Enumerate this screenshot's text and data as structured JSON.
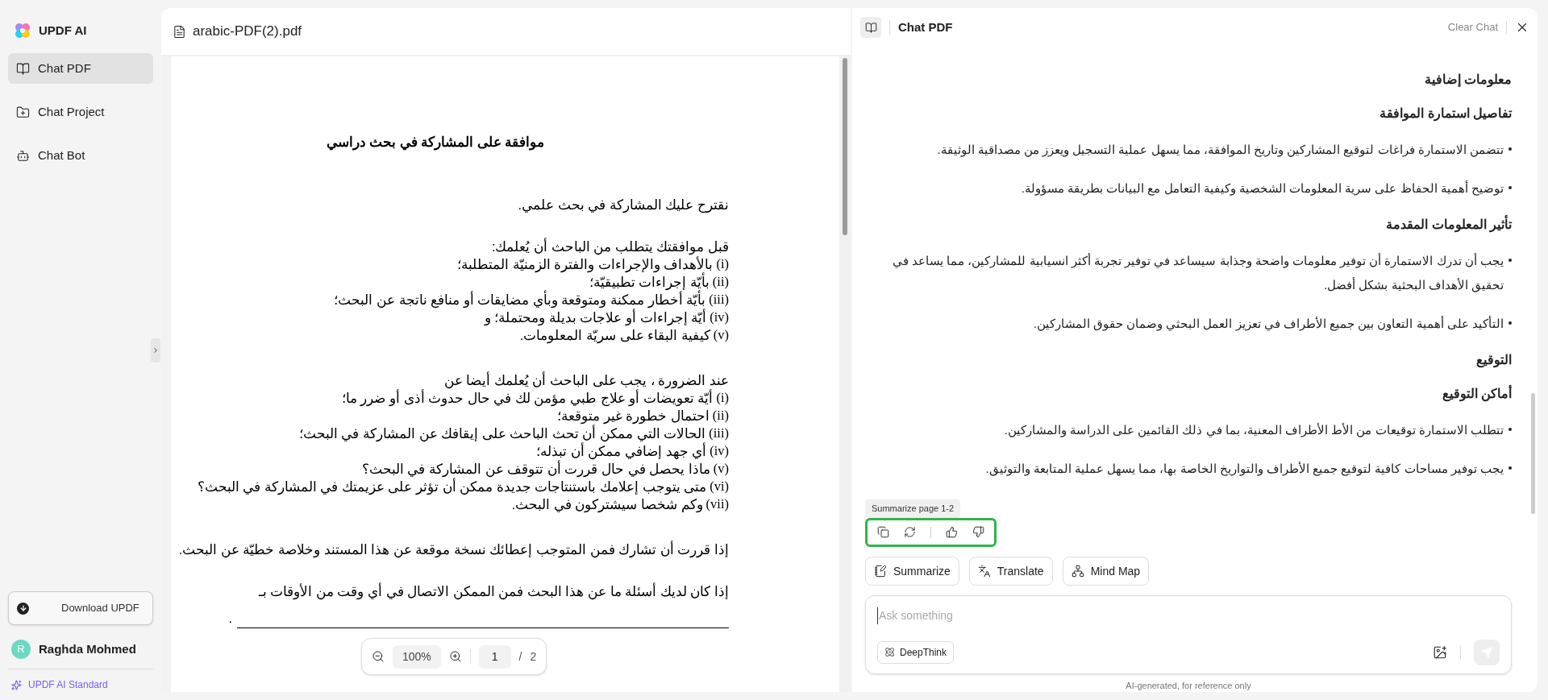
{
  "app": {
    "name": "UPDF AI"
  },
  "sidebar": {
    "items": [
      {
        "label": "Chat PDF",
        "kind": "pdf",
        "selected": true
      },
      {
        "label": "Chat Project",
        "kind": "project",
        "selected": false
      },
      {
        "label": "Chat Bot",
        "kind": "bot",
        "selected": false
      }
    ],
    "download_button": "Download UPDF",
    "user": {
      "initial": "R",
      "name": "Raghda Mohmed"
    },
    "plan": "UPDF AI Standard"
  },
  "document": {
    "filename": "arabic-PDF(2).pdf",
    "title": "موافقة على المشاركة في بحث دراسي",
    "blocks": [
      {
        "kind": "para",
        "text": "نقترح عليك المشاركة في بحث علمي."
      },
      {
        "kind": "list",
        "intro": "قبل موافقتك يتطلب من الباحث أن يُعلمك:",
        "items": [
          {
            "marker": "(i)",
            "text": "بالأهداف والإجراءات والفترة الزمنيّة المتطلبة؛"
          },
          {
            "marker": "(ii)",
            "text": "بأيّة إجراءات تطبيقيّة؛"
          },
          {
            "marker": "(iii)",
            "text": "بأيّة أخطار ممكنة ومتوقعة وبأي مضايقات أو منافع ناتجة عن البحث؛"
          },
          {
            "marker": "(iv)",
            "text": "أيّة إجراءات أو علاجات بديلة ومحتملة؛ و"
          },
          {
            "marker": "(v)",
            "text": "كيفية البقاء على سريّة المعلومات."
          }
        ]
      },
      {
        "kind": "list",
        "intro": "عند الضرورة ، يجب على الباحث أن يُعلمك أيضا عن",
        "items": [
          {
            "marker": "(i)",
            "text": "أيّة تعويضات أو علاج طبي مؤمن لك في حال حدوث أذى أو ضرر ما؛"
          },
          {
            "marker": "(ii)",
            "text": "احتمال خطورة غير متوقعة؛"
          },
          {
            "marker": "(iii)",
            "text": "الحالات التي ممكن أن تحث الباحث على إيقافك عن المشاركة في البحث؛"
          },
          {
            "marker": "(iv)",
            "text": "أي جهد إضافي ممكن أن تبذله؛"
          },
          {
            "marker": "(v)",
            "text": "ماذا يحصل في حال قررت أن تتوقف عن المشاركة في البحث؟"
          },
          {
            "marker": "(vi)",
            "text": "متى يتوجب إعلامك باستنتاجات جديدة ممكن أن تؤثر على عزيمتك في المشاركة في البحث؟"
          },
          {
            "marker": "(vii)",
            "text": "وكم شخصا سيشتركون في البحث."
          }
        ]
      },
      {
        "kind": "para",
        "text": "إذا قررت أن تشارك فمن المتوجب إعطائك نسخة موقعة عن هذا المستند وخلاصة خطيّة عن البحث."
      },
      {
        "kind": "para",
        "text": "إذا كان لديك أسئلة ما عن هذا البحث فمن الممكن الاتصال في أي وقت من الأوقات بـ"
      },
      {
        "kind": "blank",
        "text": "."
      }
    ],
    "zoom": "100%",
    "page": "1",
    "page_separator": "/",
    "page_total": "2"
  },
  "chat": {
    "title": "Chat PDF",
    "clear": "Clear Chat",
    "blocks": [
      {
        "kind": "heading",
        "text": "معلومات إضافية"
      },
      {
        "kind": "heading",
        "text": "تفاصيل استمارة الموافقة"
      },
      {
        "kind": "bullet",
        "text": "تتضمن الاستمارة فراغات لتوقيع المشاركين وتاريخ الموافقة، مما يسهل عملية التسجيل ويعزز من مصداقية الوثيقة."
      },
      {
        "kind": "bullet",
        "text": "توضيح أهمية الحفاظ على سرية المعلومات الشخصية وكيفية التعامل مع البيانات بطريقة مسؤولة."
      },
      {
        "kind": "heading",
        "text": "تأثير المعلومات المقدمة"
      },
      {
        "kind": "bullet",
        "text": "يجب أن تدرك الاستمارة أن توفير معلومات واضحة وجذابة سيساعد في توفير تجربة أكثر انسيابية للمشاركين، مما يساعد في تحقيق الأهداف البحثية بشكل أفضل."
      },
      {
        "kind": "bullet",
        "text": "التأكيد على أهمية التعاون بين جميع الأطراف في تعزيز العمل البحثي وضمان حقوق المشاركين."
      },
      {
        "kind": "heading",
        "text": "التوقيع"
      },
      {
        "kind": "heading",
        "text": "أماكن التوقيع"
      },
      {
        "kind": "bullet",
        "text": "تتطلب الاستمارة توقيعات من الأط الأطراف المعنية، بما في ذلك القائمين على الدراسة والمشاركين."
      },
      {
        "kind": "bullet",
        "text": "يجب توفير مساحات كافية لتوقيع جميع الأطراف والتواريخ الخاصة بها، مما يسهل عملية المتابعة والتوثيق."
      }
    ],
    "summary_chip": "Summarize page 1-2",
    "actions_highlighted": true,
    "summarize_button": "Summarize",
    "translate_button": "Translate",
    "mind_map_button": "Mind Map",
    "input": {
      "placeholder": "Ask something"
    },
    "deepthink": "DeepThink",
    "footer": "AI-generated, for reference only"
  }
}
